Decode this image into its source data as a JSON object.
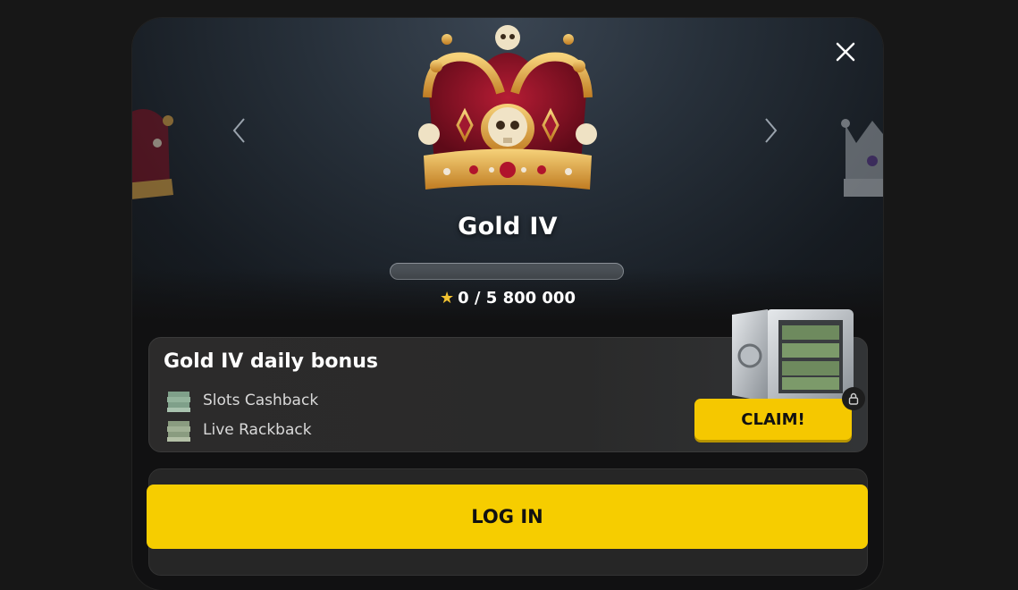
{
  "level": {
    "title": "Gold IV",
    "points_current": "0",
    "points_text": "0 / 5 800 000",
    "progress_fraction": 0
  },
  "bonus": {
    "title": "Gold IV daily bonus",
    "items": [
      {
        "label": "Slots Cashback",
        "icon": "cash-stack-icon"
      },
      {
        "label": "Live Rackback",
        "icon": "cash-stack-icon"
      }
    ],
    "claim_label": "CLAIM!"
  },
  "actions": {
    "login_label": "LOG IN"
  },
  "colors": {
    "accent": "#f5c800",
    "background": "#171717",
    "card": "#2c2b2b",
    "crown_gold": "#e0a838",
    "crown_velvet": "#8a1226"
  },
  "icons": [
    "close-icon",
    "chevron-left-icon",
    "chevron-right-icon",
    "star-icon",
    "crown-icon",
    "safe-icon",
    "lock-icon"
  ]
}
